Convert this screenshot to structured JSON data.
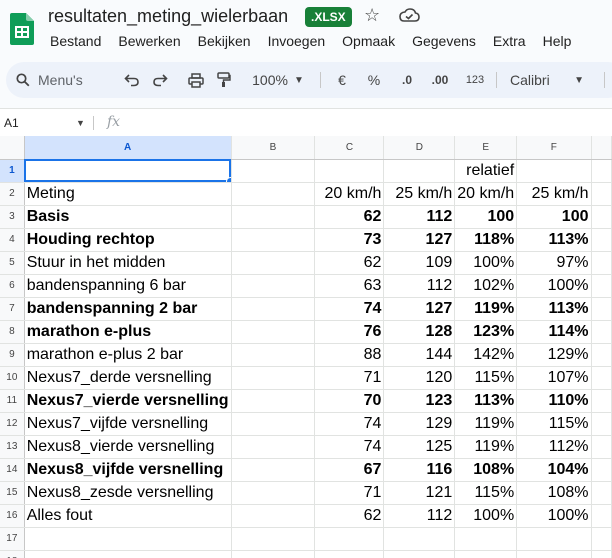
{
  "app": {
    "doc_title": "resultaten_meting_wielerbaan",
    "file_ext": ".XLSX",
    "menus": [
      "Bestand",
      "Bewerken",
      "Bekijken",
      "Invoegen",
      "Opmaak",
      "Gegevens",
      "Extra",
      "Help"
    ]
  },
  "toolbar": {
    "search_label": "Menu's",
    "zoom": "100%",
    "currency": "€",
    "percent": "%",
    "decrease_decimals": ".0",
    "increase_decimals": ".00",
    "number_format": "123",
    "font": "Calibri"
  },
  "formula_bar": {
    "cell_ref": "A1",
    "fx": "fx",
    "content": ""
  },
  "colors": {
    "accent": "#1a73e8",
    "brand_green": "#188038",
    "header_bg": "#f8f9fa",
    "active_header_bg": "#d3e3fd"
  },
  "sheet": {
    "columns": [
      "A",
      "B",
      "C",
      "D",
      "E",
      "F"
    ],
    "active_cell": "A1",
    "rows": [
      {
        "n": "1",
        "bold": false,
        "a": "",
        "b": "",
        "c": "",
        "d": "",
        "e": "relatief",
        "f": ""
      },
      {
        "n": "2",
        "bold": false,
        "a": "Meting",
        "b": "",
        "c": "20 km/h",
        "d": "25 km/h",
        "e": "20 km/h",
        "f": "25 km/h"
      },
      {
        "n": "3",
        "bold": true,
        "a": "Basis",
        "b": "",
        "c": "62",
        "d": "112",
        "e": "100",
        "f": "100"
      },
      {
        "n": "4",
        "bold": true,
        "a": "Houding rechtop",
        "b": "",
        "c": "73",
        "d": "127",
        "e": "118%",
        "f": "113%"
      },
      {
        "n": "5",
        "bold": false,
        "a": "Stuur in het midden",
        "b": "",
        "c": "62",
        "d": "109",
        "e": "100%",
        "f": "97%"
      },
      {
        "n": "6",
        "bold": false,
        "a": "bandenspanning 6 bar",
        "b": "",
        "c": "63",
        "d": "112",
        "e": "102%",
        "f": "100%"
      },
      {
        "n": "7",
        "bold": true,
        "a": "bandenspanning 2 bar",
        "b": "",
        "c": "74",
        "d": "127",
        "e": "119%",
        "f": "113%"
      },
      {
        "n": "8",
        "bold": true,
        "a": "marathon e-plus",
        "b": "",
        "c": "76",
        "d": "128",
        "e": "123%",
        "f": "114%"
      },
      {
        "n": "9",
        "bold": false,
        "a": "marathon e-plus 2 bar",
        "b": "",
        "c": "88",
        "d": "144",
        "e": "142%",
        "f": "129%"
      },
      {
        "n": "10",
        "bold": false,
        "a": "Nexus7_derde versnelling",
        "b": "",
        "c": "71",
        "d": "120",
        "e": "115%",
        "f": "107%"
      },
      {
        "n": "11",
        "bold": true,
        "a": "Nexus7_vierde versnelling",
        "b": "",
        "c": "70",
        "d": "123",
        "e": "113%",
        "f": "110%"
      },
      {
        "n": "12",
        "bold": false,
        "a": "Nexus7_vijfde versnelling",
        "b": "",
        "c": "74",
        "d": "129",
        "e": "119%",
        "f": "115%"
      },
      {
        "n": "13",
        "bold": false,
        "a": "Nexus8_vierde versnelling",
        "b": "",
        "c": "74",
        "d": "125",
        "e": "119%",
        "f": "112%"
      },
      {
        "n": "14",
        "bold": true,
        "a": "Nexus8_vijfde versnelling",
        "b": "",
        "c": "67",
        "d": "116",
        "e": "108%",
        "f": "104%"
      },
      {
        "n": "15",
        "bold": false,
        "a": "Nexus8_zesde versnelling",
        "b": "",
        "c": "71",
        "d": "121",
        "e": "115%",
        "f": "108%"
      },
      {
        "n": "16",
        "bold": false,
        "a": "Alles fout",
        "b": "",
        "c": "62",
        "d": "112",
        "e": "100%",
        "f": "100%"
      },
      {
        "n": "17",
        "bold": false,
        "a": "",
        "b": "",
        "c": "",
        "d": "",
        "e": "",
        "f": ""
      },
      {
        "n": "18",
        "bold": false,
        "a": "",
        "b": "",
        "c": "",
        "d": "",
        "e": "",
        "f": ""
      }
    ]
  }
}
